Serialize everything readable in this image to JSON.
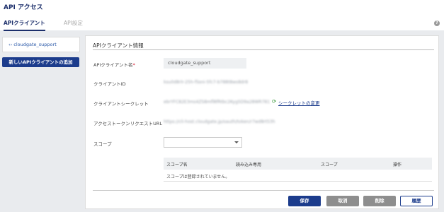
{
  "page": {
    "title": "API アクセス"
  },
  "tabs": [
    {
      "label": "APIクライアント"
    },
    {
      "label": "API設定"
    }
  ],
  "help": {
    "glyph": "?"
  },
  "sidebar": {
    "items": [
      {
        "icon": "‹›",
        "label": "cloudgate_support"
      }
    ],
    "new_client_label": "新しいAPIクライアントの追加"
  },
  "form": {
    "section_title": "APIクライアント情報",
    "client_name": {
      "label": "APIクライアント名",
      "required_mark": "*",
      "value": "cloudgate_support"
    },
    "client_id": {
      "label": "クライアントID",
      "value": "ksu0d8rlr-25h-fSsni-5fc7-b788t8ws8dr8"
    },
    "client_secret": {
      "label": "クライアントシークレット",
      "value": "ebrYFC82E3ms4ZS8mfl8fRtbc2Kyg5D9a28WR781",
      "change_label": "シークレットの変更"
    },
    "token_url": {
      "label": "アクセストークンリクエストURL",
      "value": "https://cli-host.cloudgate.jp/oauth/token/r7wd8rt53h"
    },
    "scope": {
      "label": "スコープ",
      "selected": ""
    }
  },
  "scope_table": {
    "columns": [
      "スコープ名",
      "読み込み専用",
      "スコープ",
      "操作"
    ],
    "empty_message": "スコープは登録されていません。"
  },
  "actions": {
    "save": "保存",
    "cancel": "取消",
    "delete": "削除",
    "history": "履歴"
  }
}
